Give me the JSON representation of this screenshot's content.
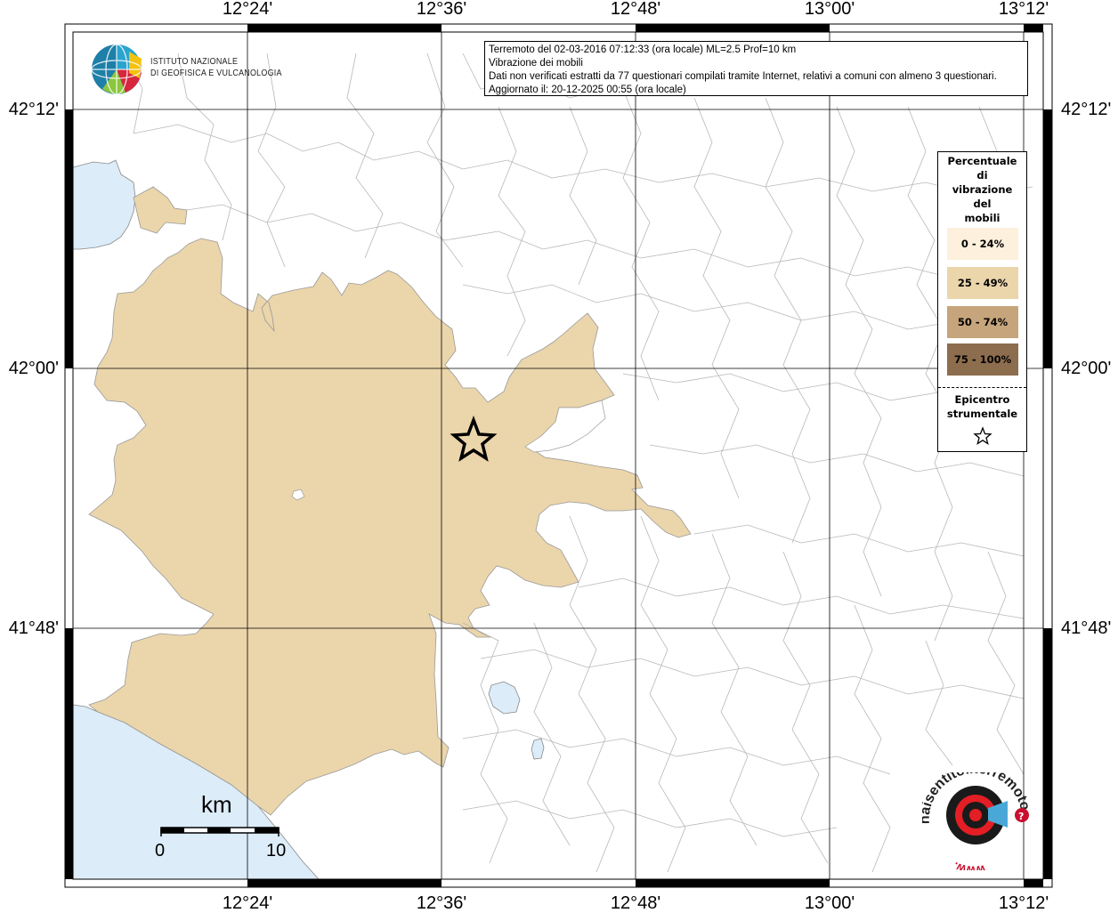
{
  "map": {
    "lon_labels": [
      "12°24'",
      "12°36'",
      "12°48'",
      "13°00'",
      "13°12'"
    ],
    "lat_labels": [
      "42°12'",
      "42°00'",
      "41°48'"
    ],
    "colors": {
      "sea": "#dcecf8",
      "land": "#ffffff",
      "municipality_border": "#aaaaaa",
      "vibration_25_49": "#ebd5ab",
      "vibration_0_24": "#fdf0dc",
      "vibration_50_74": "#c6a57c",
      "vibration_75_100": "#8c6d4e"
    }
  },
  "info": {
    "line1": "Terremoto del 02-03-2016 07:12:33 (ora locale) ML=2.5 Prof=10 km",
    "line2": "Vibrazione dei mobili",
    "line3": "Dati non verificati estratti da 77 questionari compilati tramite Internet, relativi a comuni con almeno 3 questionari.",
    "line4": "Aggiornato il: 20-12-2025 00:55 (ora locale)"
  },
  "institute": {
    "line1": "ISTITUTO NAZIONALE",
    "line2": "DI GEOFISICA E VULCANOLOGIA"
  },
  "legend": {
    "title_lines": [
      "Percentuale",
      "di",
      "vibrazione",
      "del",
      "mobili"
    ],
    "classes": [
      {
        "label": "0 - 24%",
        "color": "#fdf0dc"
      },
      {
        "label": "25 - 49%",
        "color": "#ebd5ab"
      },
      {
        "label": "50 - 74%",
        "color": "#c6a57c"
      },
      {
        "label": "75 - 100%",
        "color": "#8c6d4e"
      }
    ],
    "epicenter_line1": "Epicentro",
    "epicenter_line2": "strumentale"
  },
  "scale": {
    "unit": "km",
    "min_label": "0",
    "max_label": "10"
  },
  "badge": {
    "text": "haisentitoilterremoto.it",
    "url_text": "www."
  }
}
